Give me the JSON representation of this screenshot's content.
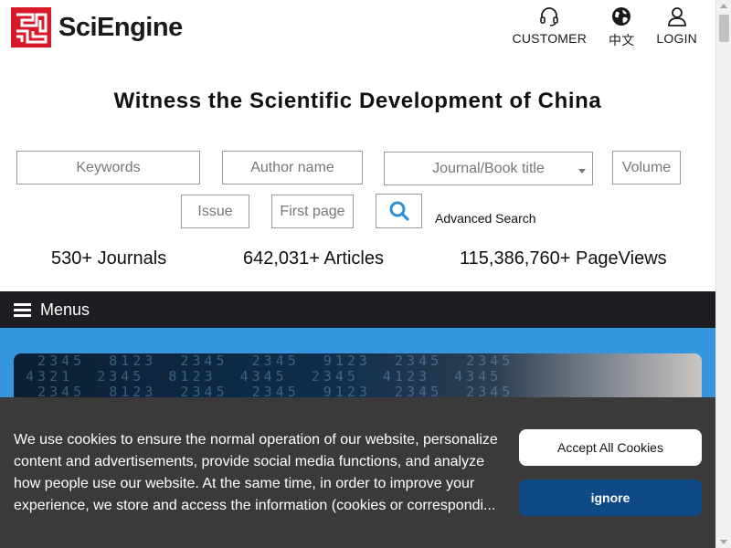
{
  "header": {
    "brand": "SciEngine",
    "actions": [
      {
        "label": "CUSTOMER",
        "icon": "headset-icon"
      },
      {
        "label": "中文",
        "icon": "globe-icon"
      },
      {
        "label": "LOGIN",
        "icon": "user-icon"
      }
    ]
  },
  "headline": "Witness the Scientific Development of China",
  "search": {
    "keywords_placeholder": "Keywords",
    "author_placeholder": "Author name",
    "journal_select_label": "Journal/Book title",
    "volume_placeholder": "Volume",
    "issue_placeholder": "Issue",
    "first_page_placeholder": "First page",
    "search_icon": "search-icon",
    "advanced_label": "Advanced Search"
  },
  "stats": {
    "journals": "530+ Journals",
    "articles": "642,031+ Articles",
    "pageviews": "115,386,760+ PageViews"
  },
  "menu": {
    "label": "Menus",
    "icon": "hamburger-icon"
  },
  "cookie": {
    "lines": [
      "We use cookies to ensure the normal operation of our website, personalize",
      "content and advertisements, provide social media functions, and analyze",
      "how people use our website. At the same time, in order to improve your",
      "experience, we store and access the information (cookies or correspondi..."
    ],
    "accept_label": "Accept All Cookies",
    "ignore_label": "ignore"
  },
  "colors": {
    "brand_red": "#d7192a",
    "menubar": "#1e1e22",
    "banner_blue": "#3595de",
    "ignore_button": "#0d4a86",
    "search_icon": "#2f8fd6"
  }
}
